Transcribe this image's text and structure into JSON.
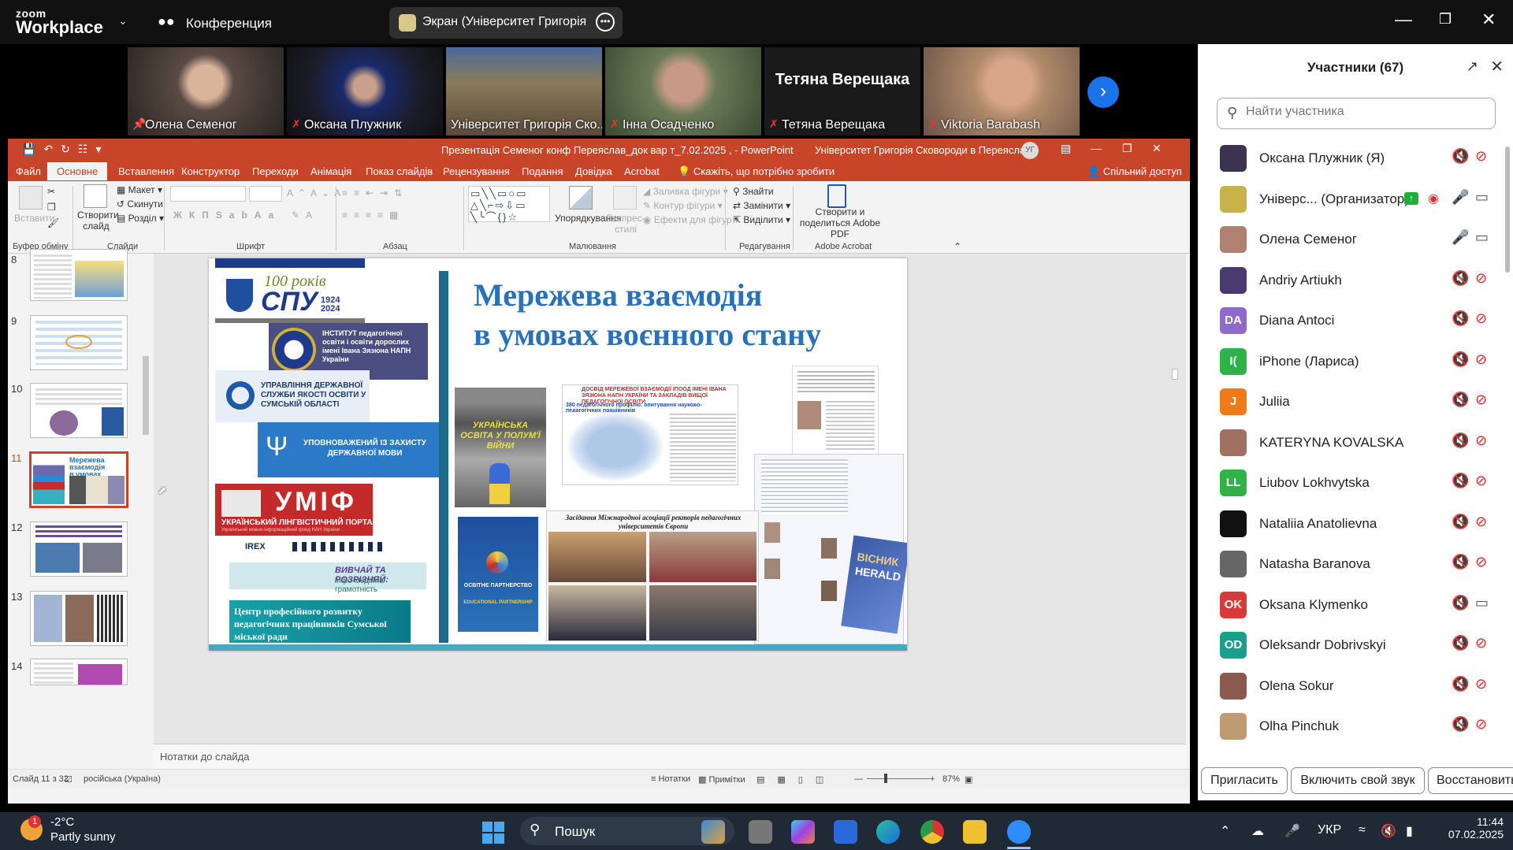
{
  "zoom": {
    "logo_top": "zoom",
    "logo_bottom": "Workplace",
    "meeting_label": "Конференция",
    "share_label": "Экран (Університет Григорія Ск"
  },
  "gallery": [
    {
      "name": "Олена Семеног",
      "color": "#5a4a44",
      "active": true
    },
    {
      "name": "Оксана Плужник",
      "color": "#2d2d3a",
      "active": false
    },
    {
      "name": "Університет Григорія Ско...",
      "color": "#6b6a52",
      "active": false
    },
    {
      "name": "Інна Осадченко",
      "color": "#6a7a58",
      "active": false
    },
    {
      "name": "Тетяна Верещака",
      "color": "#1a1a1a",
      "active": false,
      "bigname": "Тетяна Верещака"
    },
    {
      "name": "Viktoria Barabash",
      "color": "#7a6458",
      "active": false
    }
  ],
  "panel": {
    "title": "Участники (67)",
    "search_placeholder": "Найти участника",
    "participants": [
      {
        "name": "Оксана Плужник (Я)",
        "avatar": "",
        "avcolor": "#3b3350",
        "mic": "off",
        "cam": "off"
      },
      {
        "name": "Універс... (Организатор)",
        "avatar": "",
        "avcolor": "#c9b24a",
        "mic": "on",
        "cam": "on",
        "host": true
      },
      {
        "name": "Олена Семеног",
        "avatar": "",
        "avcolor": "#b08070",
        "mic": "on",
        "cam": "on"
      },
      {
        "name": "Andriy Artiukh",
        "avatar": "",
        "avcolor": "#4a3a70",
        "mic": "off",
        "cam": "off"
      },
      {
        "name": "Diana Antoci",
        "avatar": "DA",
        "avcolor": "#8e6bc9",
        "mic": "off",
        "cam": "off"
      },
      {
        "name": "iPhone (Лариса)",
        "avatar": "I(",
        "avcolor": "#2fb24a",
        "mic": "off",
        "cam": "off"
      },
      {
        "name": "Juliia",
        "avatar": "J",
        "avcolor": "#f07a16",
        "mic": "off",
        "cam": "off"
      },
      {
        "name": "KATERYNA KOVALSKA",
        "avatar": "",
        "avcolor": "#a07060",
        "mic": "off",
        "cam": "off"
      },
      {
        "name": "Liubov Lokhvytska",
        "avatar": "LL",
        "avcolor": "#2fb24a",
        "mic": "off",
        "cam": "off"
      },
      {
        "name": "Nataliia Anatolievna",
        "avatar": "",
        "avcolor": "#111111",
        "mic": "off",
        "cam": "off"
      },
      {
        "name": "Natasha Baranova",
        "avatar": "",
        "avcolor": "#666666",
        "mic": "off",
        "cam": "off"
      },
      {
        "name": "Oksana Klymenko",
        "avatar": "OK",
        "avcolor": "#d63b3b",
        "mic": "off",
        "cam": "on"
      },
      {
        "name": "Oleksandr Dobrivskyi",
        "avatar": "OD",
        "avcolor": "#19a08a",
        "mic": "off",
        "cam": "off"
      },
      {
        "name": "Olena Sokur",
        "avatar": "",
        "avcolor": "#8a5a50",
        "mic": "off",
        "cam": "off"
      },
      {
        "name": "Olha Pinchuk",
        "avatar": "",
        "avcolor": "#c09a70",
        "mic": "off",
        "cam": "off"
      }
    ],
    "buttons": {
      "invite": "Пригласить",
      "unmute": "Включить свой звук",
      "restore": "Восстановить"
    }
  },
  "ppt": {
    "title": "Презентація Семеног конф Переяслав_док вар т_7.02.2025 ,  -  PowerPoint",
    "account": "Університет Григорія Сковороди в Переяславі",
    "avatar_initials": "УГ",
    "tabs": [
      "Файл",
      "Основне",
      "Вставлення",
      "Конструктор",
      "Переходи",
      "Анімація",
      "Показ слайдів",
      "Рецензування",
      "Подання",
      "Довідка",
      "Acrobat",
      "Скажіть, що потрібно зробити",
      "Спільний доступ"
    ],
    "ribbon": {
      "paste": "Вставити",
      "new_slide": "Створити слайд",
      "layout": "Макет",
      "reset": "Скинути",
      "section": "Розділ",
      "groups": [
        "Буфер обміну",
        "Слайди",
        "Шрифт",
        "Абзац",
        "Малювання",
        "Редагування",
        "Adobe Acrobat"
      ],
      "arrange": "Упорядкування",
      "quick_styles": "Експрес-стилі",
      "fill": "Заливка фігури",
      "outline": "Контур фігури",
      "effects": "Ефекти для фігур",
      "find": "Знайти",
      "replace": "Замінити",
      "select": "Виділити",
      "acrobat": "Створити и поделиться Adobe PDF"
    },
    "thumbs": [
      {
        "num": "8"
      },
      {
        "num": "9"
      },
      {
        "num": "10"
      },
      {
        "num": "11",
        "selected": true
      },
      {
        "num": "12"
      },
      {
        "num": "13"
      },
      {
        "num": "14"
      }
    ],
    "slide": {
      "title_line1": "Мережева взаємодія",
      "title_line2": "в умовах воєнного стану",
      "spu_years": "100 років",
      "spu_name": "СПУ",
      "spu_years_range": "1924 2024",
      "institute": "ІНСТИТУТ педагогічної освіти і освіти дорослих імені Івана Зязюна НАПН України",
      "sumy": "УПРАВЛІННЯ ДЕРЖАВНОЇ СЛУЖБИ ЯКОСТІ ОСВІТИ У СУМСЬКІЙ ОБЛАСТІ",
      "ombudsman": "УПОВНОВАЖЕНИЙ ІЗ ЗАХИСТУ ДЕРЖАВНОЇ МОВИ",
      "umif": "УМІФ",
      "umif_sub": "УКРАЇНСЬКИЙ ЛІНГВІСТИЧНИЙ ПОРТАЛ",
      "umif_sub2": "Український мовно-інформаційний фонд НАН України",
      "learn": "ВИВЧАЙ ТА РОЗРІЗНЯЙ:",
      "learn_sub": "інфо-медійна грамотність",
      "irex": "IREX",
      "centre": "Центр професійного розвитку педагогічних працівників Сумської міської ради",
      "war_book": "УКРАЇНСЬКА ОСВІТА У ПОЛУМ'Ї ВІЙНИ",
      "map_title": "ДОСВІД МЕРЕЖЕВОЇ ВЗАЄМОДІЇ ІПООД ІМЕНІ ІВАНА ЗЯЗЮНА НАПН УКРАЇНИ ТА ЗАКЛАДІВ ВИЩОЇ ПЕДАГОГІЧНОЇ ОСВІТИ",
      "map_sub": "380 педагогічного профілю: опитування науково-педагогічних працівників",
      "meeting": "Засідання Міжнародної асоціації ректорів педагогічних університетів Європи",
      "partnership": "ОСВІТНЄ ПАРТНЕРСТВО",
      "partnership_en": "EDUCATIONAL PARTNERSHIP",
      "herald": "HERALD",
      "visnyk": "ВІСНИК"
    },
    "notes": "Нотатки до слайда",
    "status": {
      "slide": "Слайд 11 з 32",
      "lang": "російська (Україна)",
      "notes_btn": "Нотатки",
      "comments_btn": "Примітки",
      "zoom": "87%"
    }
  },
  "taskbar": {
    "badge": "1",
    "temp": "-2°C",
    "weather": "Partly sunny",
    "search": "Пошук",
    "lang": "УКР",
    "time": "11:44",
    "date": "07.02.2025"
  }
}
